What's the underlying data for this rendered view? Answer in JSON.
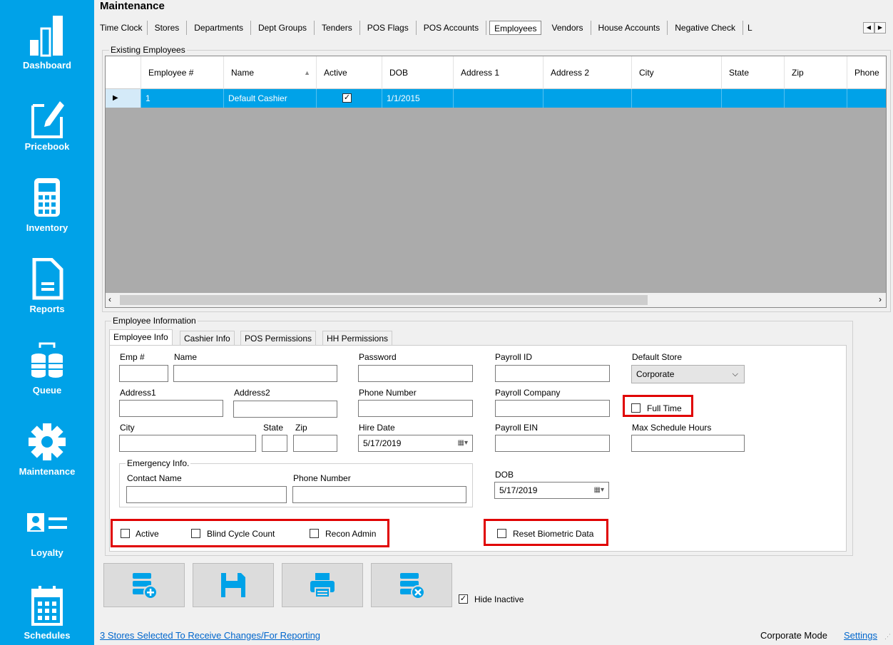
{
  "sidebar": {
    "items": [
      {
        "label": "Dashboard",
        "icon": "bar-chart-icon"
      },
      {
        "label": "Pricebook",
        "icon": "edit-document-icon"
      },
      {
        "label": "Inventory",
        "icon": "calculator-icon"
      },
      {
        "label": "Reports",
        "icon": "report-document-icon"
      },
      {
        "label": "Queue",
        "icon": "database-sync-icon"
      },
      {
        "label": "Maintenance",
        "icon": "gear-icon"
      },
      {
        "label": "Loyalty",
        "icon": "id-card-icon"
      },
      {
        "label": "Schedules",
        "icon": "calendar-icon"
      }
    ]
  },
  "page": {
    "title": "Maintenance"
  },
  "tabs": [
    "Time Clock",
    "Stores",
    "Departments",
    "Dept Groups",
    "Tenders",
    "POS Flags",
    "POS Accounts",
    "Employees",
    "Vendors",
    "House Accounts",
    "Negative Check",
    "L"
  ],
  "active_tab": "Employees",
  "existing": {
    "legend": "Existing Employees",
    "columns": [
      "Employee #",
      "Name",
      "Active",
      "DOB",
      "Address 1",
      "Address 2",
      "City",
      "State",
      "Zip",
      "Phone"
    ],
    "rows": [
      {
        "emp_no": "1",
        "name": "Default Cashier",
        "active": true,
        "dob": "1/1/2015",
        "address1": "",
        "address2": "",
        "city": "",
        "state": "",
        "zip": "",
        "phone": ""
      }
    ]
  },
  "info": {
    "legend": "Employee Information",
    "tabs": [
      "Employee Info",
      "Cashier Info",
      "POS Permissions",
      "HH Permissions"
    ],
    "labels": {
      "emp_no": "Emp #",
      "name": "Name",
      "password": "Password",
      "payroll_id": "Payroll ID",
      "default_store": "Default Store",
      "address1": "Address1",
      "address2": "Address2",
      "phone_number": "Phone Number",
      "payroll_company": "Payroll Company",
      "full_time": "Full Time",
      "city": "City",
      "state": "State",
      "zip": "Zip",
      "hire_date": "Hire Date",
      "payroll_ein": "Payroll EIN",
      "max_schedule_hours": "Max Schedule Hours",
      "emergency_legend": "Emergency Info.",
      "contact_name": "Contact Name",
      "emergency_phone": "Phone Number",
      "dob": "DOB",
      "active": "Active",
      "blind_cycle_count": "Blind Cycle Count",
      "recon_admin": "Recon Admin",
      "reset_biometric": "Reset Biometric Data"
    },
    "values": {
      "default_store": "Corporate",
      "hire_date": "5/17/2019",
      "dob": "5/17/2019"
    }
  },
  "actions": {
    "hide_inactive_label": "Hide Inactive",
    "hide_inactive_checked": true
  },
  "status": {
    "stores_link": "3 Stores Selected To Receive Changes/For Reporting",
    "mode": "Corporate Mode",
    "settings": "Settings"
  },
  "colors": {
    "sidebar": "#00a2e8",
    "selection": "#00a2e8",
    "highlight": "#e00000"
  }
}
